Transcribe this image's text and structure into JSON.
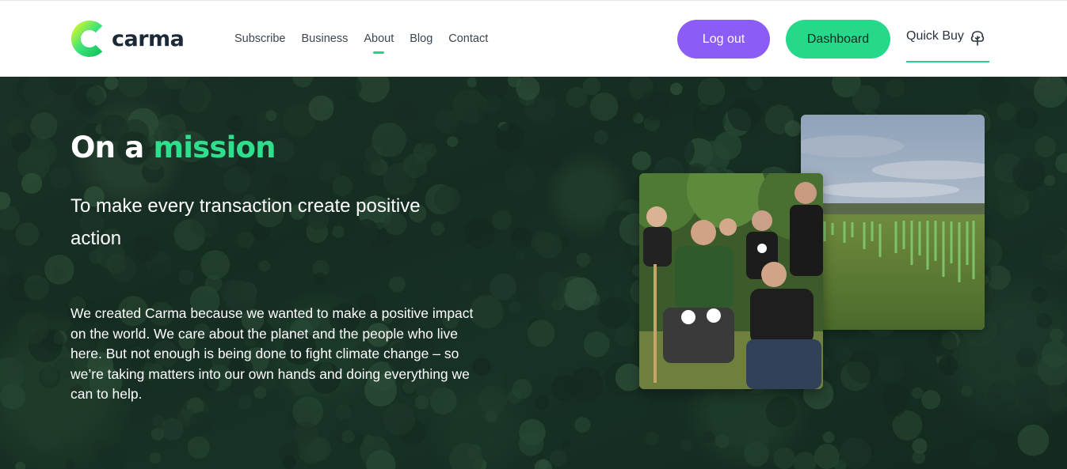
{
  "brand": {
    "name": "carma",
    "logo_icon": "carma-c-logo",
    "colors": {
      "green": "#26d98a",
      "purple": "#8c5cf6",
      "dark": "#1b2a36"
    }
  },
  "nav": {
    "items": [
      {
        "label": "Subscribe",
        "active": false
      },
      {
        "label": "Business",
        "active": false
      },
      {
        "label": "About",
        "active": true
      },
      {
        "label": "Blog",
        "active": false
      },
      {
        "label": "Contact",
        "active": false
      }
    ]
  },
  "actions": {
    "logout_label": "Log out",
    "dashboard_label": "Dashboard",
    "quickbuy_label": "Quick Buy",
    "quickbuy_icon": "tree-icon"
  },
  "hero": {
    "title_prefix": "On a",
    "title_accent": "mission",
    "subtitle": "To make every transaction create positive action",
    "body": "We created Carma because we wanted to make a positive impact on the world. We care about the planet and the people who live here. But not enough is being done to fight climate change – so we’re taking matters into our own hands and doing everything we can to help."
  }
}
